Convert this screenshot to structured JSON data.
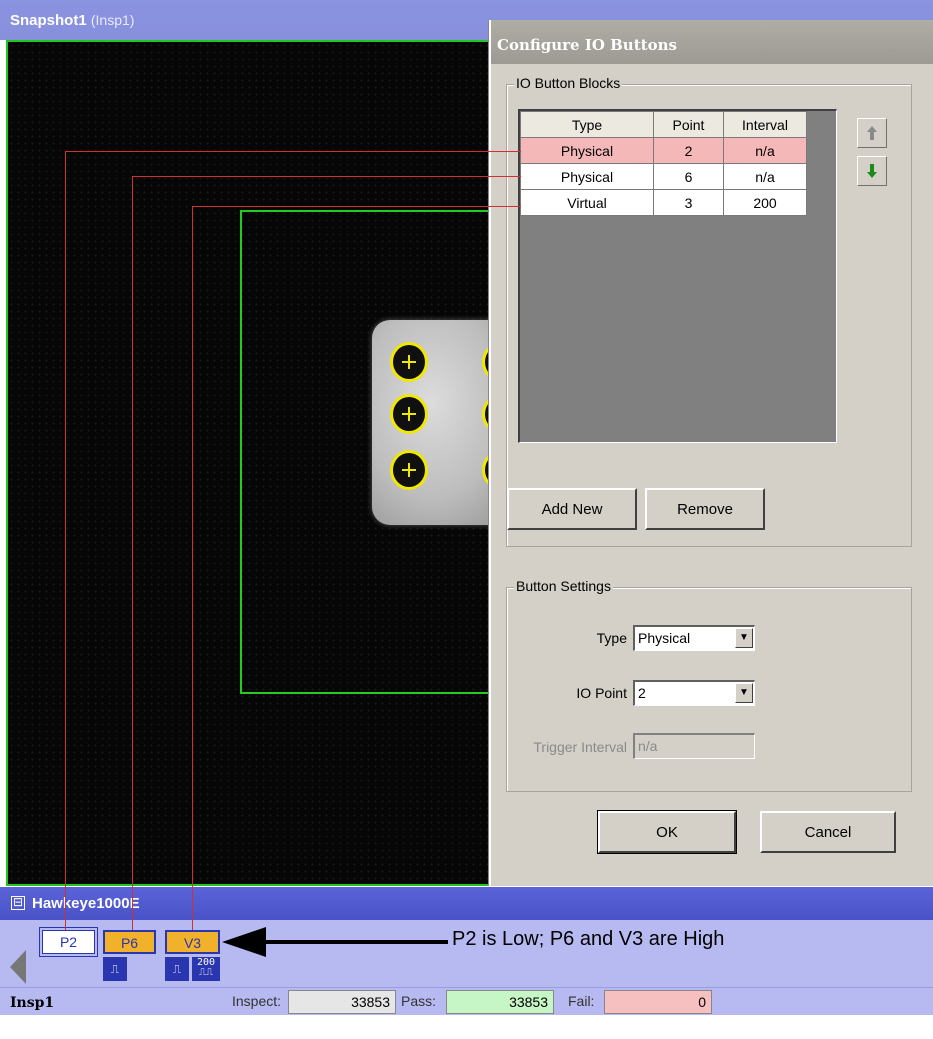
{
  "snapshot": {
    "title": "Snapshot1",
    "subtitle": "(Insp1)"
  },
  "dialog": {
    "title": "Configure IO Buttons",
    "blocks_group_label": "IO Button Blocks",
    "table": {
      "headers": [
        "Type",
        "Point",
        "Interval"
      ],
      "rows": [
        {
          "type": "Physical",
          "point": "2",
          "interval": "n/a"
        },
        {
          "type": "Physical",
          "point": "6",
          "interval": "n/a"
        },
        {
          "type": "Virtual",
          "point": "3",
          "interval": "200"
        }
      ]
    },
    "move_up_icon": "arrow-up-icon",
    "move_down_icon": "arrow-down-icon",
    "add_new_label": "Add New",
    "remove_label": "Remove",
    "settings_group_label": "Button Settings",
    "type_label": "Type",
    "type_value": "Physical",
    "io_point_label": "IO Point",
    "io_point_value": "2",
    "trigger_interval_label": "Trigger Interval",
    "trigger_interval_value": "n/a",
    "ok_label": "OK",
    "cancel_label": "Cancel"
  },
  "hawkeye": {
    "collapse_symbol": "⊟",
    "title": "Hawkeye1000E",
    "buttons": [
      {
        "label": "P2",
        "state": "low"
      },
      {
        "label": "P6",
        "state": "high"
      },
      {
        "label": "V3",
        "state": "high"
      }
    ],
    "pulse_glyph": "⎍",
    "interval_value": "200",
    "interval_glyph": "⎍⎍",
    "annotation": "P2 is Low; P6 and V3 are High"
  },
  "status": {
    "name": "Insp1",
    "inspect_label": "Inspect:",
    "inspect_value": "33853",
    "pass_label": "Pass:",
    "pass_value": "33853",
    "fail_label": "Fail:",
    "fail_value": "0"
  },
  "colors": {
    "roi": "#22cc22",
    "selected_row": "#f5b8b8",
    "io_high": "#f2b12a",
    "io_low": "#ffffff",
    "pass_bg": "#c6f5c6",
    "fail_bg": "#f7c0c0",
    "inspect_bg": "#e6e6e6",
    "callout_line": "#d03030"
  }
}
